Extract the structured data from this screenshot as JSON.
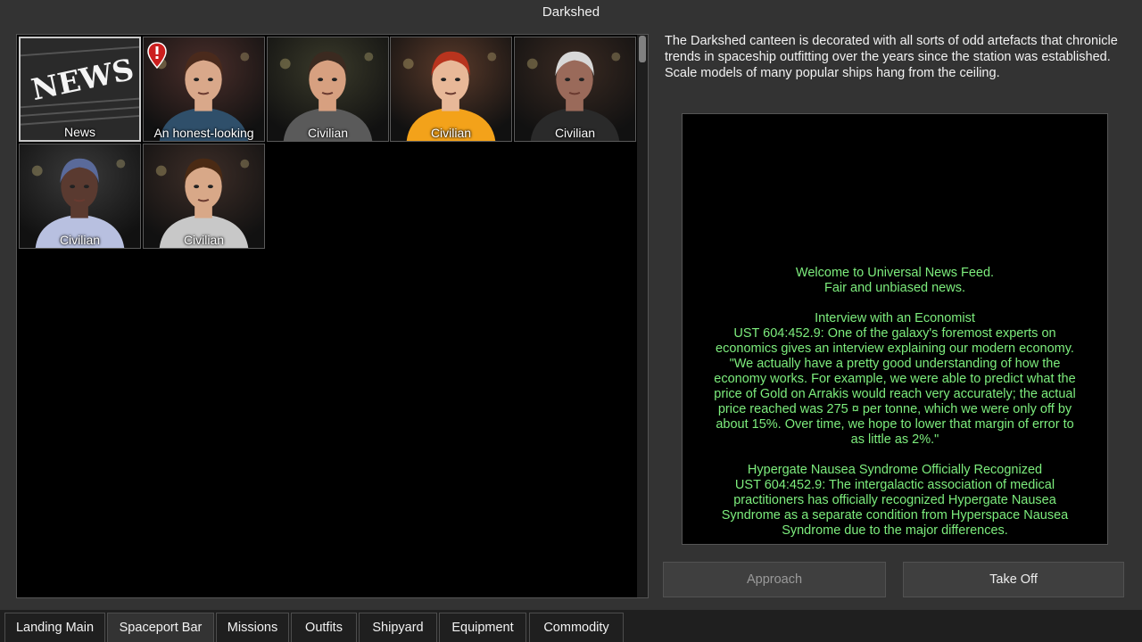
{
  "window": {
    "title": "Darkshed"
  },
  "bar_list": {
    "items": [
      {
        "label": "News",
        "kind": "news",
        "selected": true,
        "alert": false
      },
      {
        "label": "An honest-looking",
        "kind": "person",
        "alert": true
      },
      {
        "label": "Civilian",
        "kind": "person",
        "alert": false
      },
      {
        "label": "Civilian",
        "kind": "person",
        "alert": false
      },
      {
        "label": "Civilian",
        "kind": "person",
        "alert": false
      },
      {
        "label": "Civilian",
        "kind": "person",
        "alert": false
      },
      {
        "label": "Civilian",
        "kind": "person",
        "alert": false
      }
    ],
    "news_logo_text": "NEWS"
  },
  "description": "The Darkshed canteen is decorated with all sorts of odd artefacts that chronicle trends in spaceship outfitting over the years since the station was established. Scale models of many popular ships hang from the ceiling.",
  "news_feed": {
    "lines": [
      "Welcome to Universal News Feed.",
      "Fair and unbiased news.",
      "",
      "Interview with an Economist",
      "UST 604:452.9: One of the galaxy's foremost experts on",
      "economics gives an interview explaining our modern economy.",
      "\"We actually have a pretty good understanding of how the",
      "economy works. For example, we were able to predict what the",
      "price of Gold on Arrakis would reach very accurately; the actual",
      "price reached was 275 ¤ per tonne, which we were only off by",
      "about 15%. Over time, we hope to lower that margin of error to",
      "as little as 2%.\"",
      "",
      "Hypergate Nausea Syndrome Officially Recognized",
      "UST 604:452.9: The intergalactic association of medical",
      "practitioners has officially recognized Hypergate Nausea",
      "Syndrome as a separate condition from Hyperspace Nausea",
      "Syndrome due to the major differences."
    ]
  },
  "buttons": {
    "approach": "Approach",
    "take_off": "Take Off"
  },
  "tabs": [
    {
      "label": "Landing Main"
    },
    {
      "label": "Spaceport Bar",
      "active": true
    },
    {
      "label": "Missions"
    },
    {
      "label": "Outfits"
    },
    {
      "label": "Shipyard"
    },
    {
      "label": "Equipment"
    },
    {
      "label": "Commodity"
    }
  ],
  "colors": {
    "news_text": "#7ded7d",
    "background": "#333333",
    "alert": "#cc1f1f"
  }
}
